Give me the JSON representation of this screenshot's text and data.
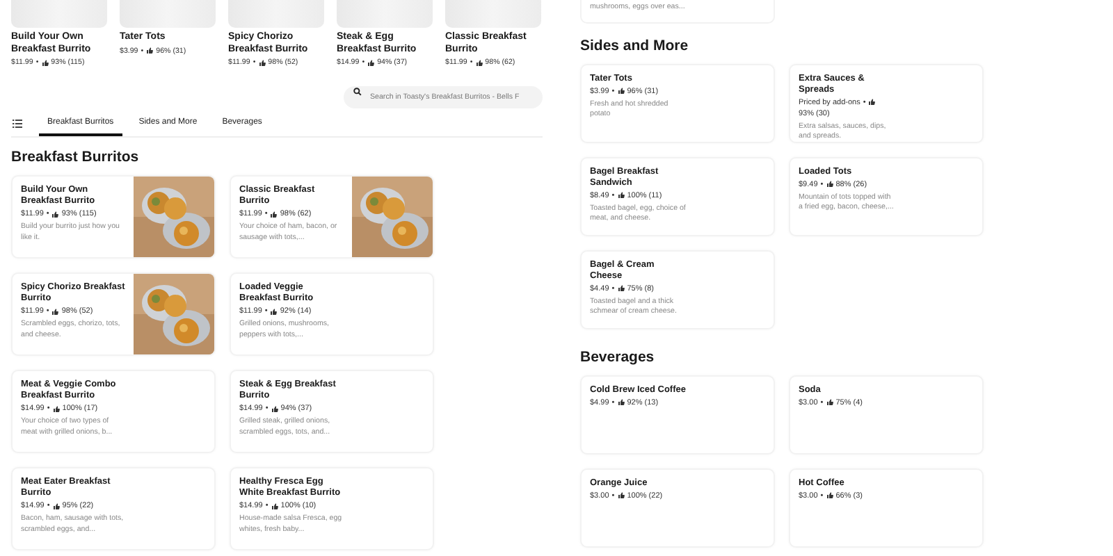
{
  "separator": "•",
  "carousel": [
    {
      "name": "Build Your Own Breakfast Burrito",
      "price": "$11.99",
      "rating": "93% (115)"
    },
    {
      "name": "Tater Tots",
      "price": "$3.99",
      "rating": "96% (31)"
    },
    {
      "name": "Spicy Chorizo Breakfast Burrito",
      "price": "$11.99",
      "rating": "98% (52)"
    },
    {
      "name": "Steak & Egg Breakfast Burrito",
      "price": "$14.99",
      "rating": "94% (37)"
    },
    {
      "name": "Classic Breakfast Burrito",
      "price": "$11.99",
      "rating": "98% (62)"
    }
  ],
  "search": {
    "placeholder": "Search in Toasty's Breakfast Burritos - Bells F"
  },
  "tabs": [
    {
      "label": "Breakfast Burritos",
      "selected": true
    },
    {
      "label": "Sides and More",
      "selected": false
    },
    {
      "label": "Beverages",
      "selected": false
    }
  ],
  "left_sections": [
    {
      "title": "Breakfast Burritos",
      "items": [
        {
          "name": "Build Your Own Breakfast Burrito",
          "price": "$11.99",
          "rating": "93% (115)",
          "description": "Build your burrito just how you like it."
        },
        {
          "name": "Classic Breakfast Burrito",
          "price": "$11.99",
          "rating": "98% (62)",
          "description": "Your choice of ham, bacon, or sausage with tots,..."
        },
        {
          "name": "Spicy Chorizo Breakfast Burrito",
          "price": "$11.99",
          "rating": "98% (52)",
          "description": "Scrambled eggs, chorizo, tots, and cheese."
        },
        {
          "name": "Loaded Veggie Breakfast Burrito",
          "price": "$11.99",
          "rating": "92% (14)",
          "description": "Grilled onions, mushrooms, peppers with tots,...",
          "kind": "placeholder"
        },
        {
          "name": "Meat & Veggie Combo Breakfast Burrito",
          "price": "$14.99",
          "rating": "100% (17)",
          "description": "Your choice of two types of meat with grilled onions, b...",
          "kind": "placeholder"
        },
        {
          "name": "Steak & Egg Breakfast Burrito",
          "price": "$14.99",
          "rating": "94% (37)",
          "description": "Grilled steak, grilled onions, scrambled eggs, tots, and...",
          "kind": "placeholder"
        },
        {
          "name": "Meat Eater Breakfast Burrito",
          "price": "$14.99",
          "rating": "95% (22)",
          "description": "Bacon, ham, sausage with tots, scrambled eggs, and...",
          "kind": "placeholder"
        },
        {
          "name": "Healthy Fresca Egg White Breakfast Burrito",
          "price": "$14.99",
          "rating": "100% (10)",
          "description": "House-made salsa Fresca, egg whites, fresh baby...",
          "kind": "placeholder"
        }
      ]
    }
  ],
  "partial_card": {
    "description": "mushrooms, eggs over eas..."
  },
  "right_sections": [
    {
      "title": "Sides and More",
      "items": [
        {
          "name": "Tater Tots",
          "price": "$3.99",
          "rating": "96% (31)",
          "description": "Fresh and hot shredded potato",
          "kind": "placeholder"
        },
        {
          "name": "Extra Sauces & Spreads",
          "price": "Priced by add-ons",
          "rating": "93% (30)",
          "description": "Extra salsas, sauces, dips, and spreads.",
          "kind": "placeholder"
        },
        {
          "name": "Bagel Breakfast Sandwich",
          "price": "$8.49",
          "rating": "100% (11)",
          "description": "Toasted bagel, egg, choice of meat, and cheese.",
          "kind": "placeholder"
        },
        {
          "name": "Loaded Tots",
          "price": "$9.49",
          "rating": "88% (26)",
          "description": "Mountain of tots topped with a fried egg, bacon, cheese,...",
          "kind": "placeholder"
        },
        {
          "name": "Bagel & Cream Cheese",
          "price": "$4.49",
          "rating": "75% (8)",
          "description": "Toasted bagel and a thick schmear of cream cheese.",
          "kind": "placeholder"
        }
      ]
    },
    {
      "title": "Beverages",
      "items": [
        {
          "name": "Cold Brew Iced Coffee",
          "price": "$4.99",
          "rating": "92% (13)",
          "kind": "none"
        },
        {
          "name": "Soda",
          "price": "$3.00",
          "rating": "75% (4)",
          "kind": "none"
        },
        {
          "name": "Orange Juice",
          "price": "$3.00",
          "rating": "100% (22)",
          "kind": "none"
        },
        {
          "name": "Hot Coffee",
          "price": "$3.00",
          "rating": "66% (3)",
          "kind": "none"
        }
      ]
    }
  ]
}
